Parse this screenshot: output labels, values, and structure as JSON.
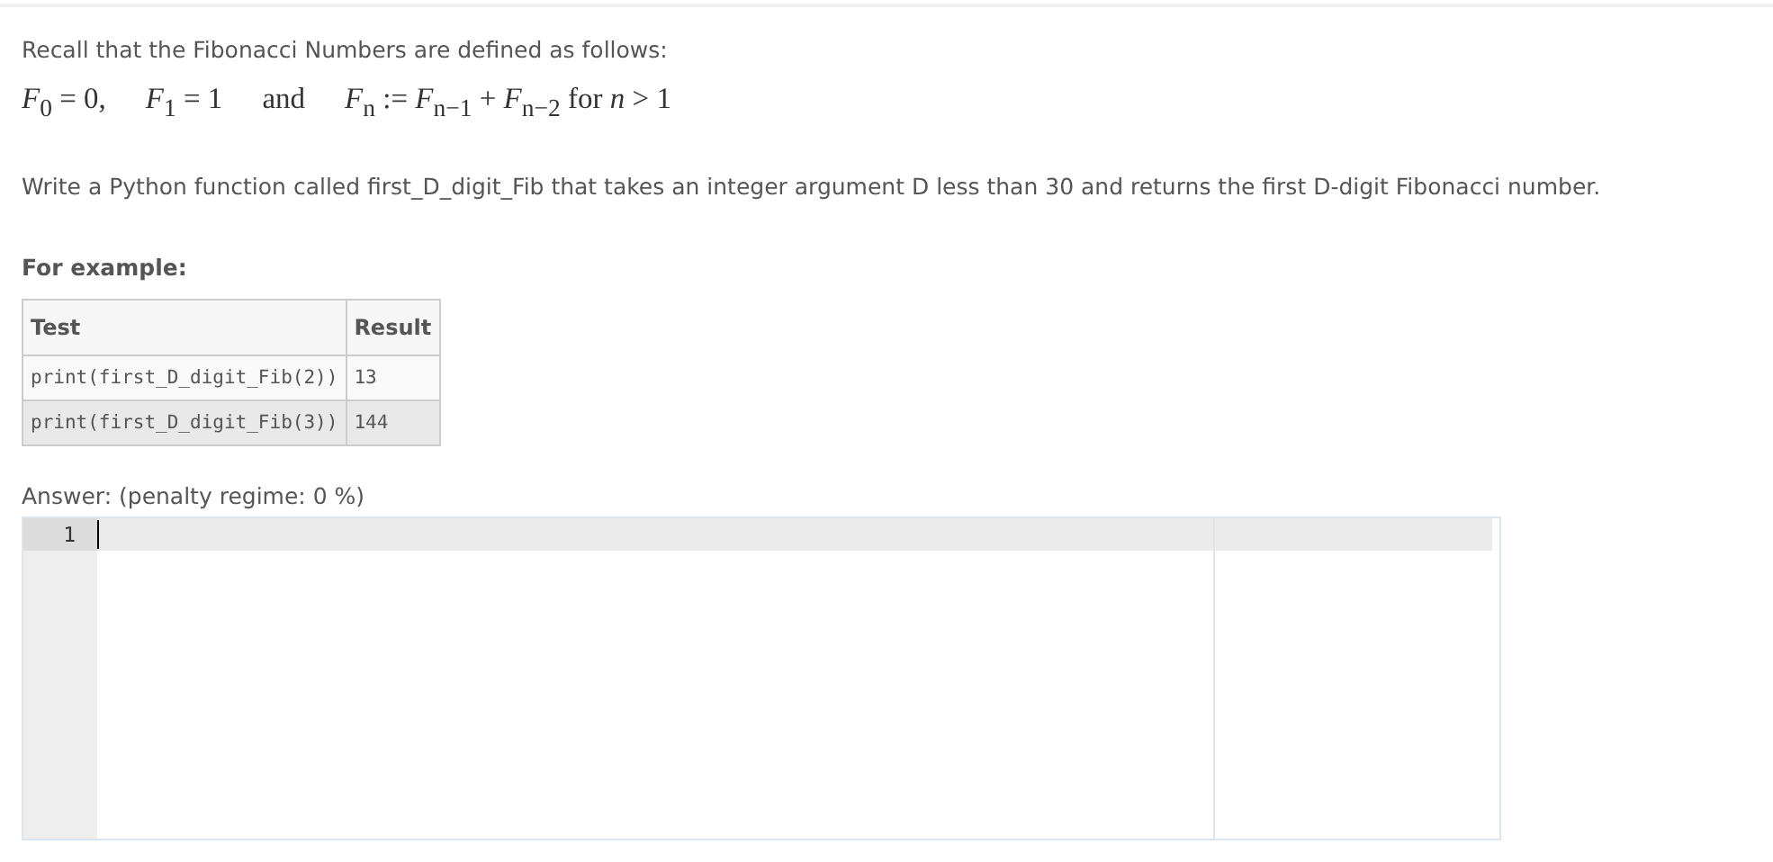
{
  "intro": "Recall that the Fibonacci Numbers are defined as follows:",
  "formula": [
    "*F*$_{0}$ = 0,",
    "*F*$_{1}$ = 1",
    "and",
    "*F*$_{n}$ := *F*$_{n−1}$ + *F*$_{n−2}$ for *n* > 1"
  ],
  "task": "Write a Python function called first_D_digit_Fib that takes an integer argument D less than 30 and returns the first D-digit Fibonacci number.",
  "example_heading": "For example:",
  "table": {
    "columns": [
      "Test",
      "Result"
    ],
    "rows": [
      [
        "print(first_D_digit_Fib(2))",
        "13"
      ],
      [
        "print(first_D_digit_Fib(3))",
        "144"
      ]
    ]
  },
  "answer_label": "Answer:  (penalty regime: 0 %)",
  "editor": {
    "line_numbers": [
      "1"
    ]
  }
}
